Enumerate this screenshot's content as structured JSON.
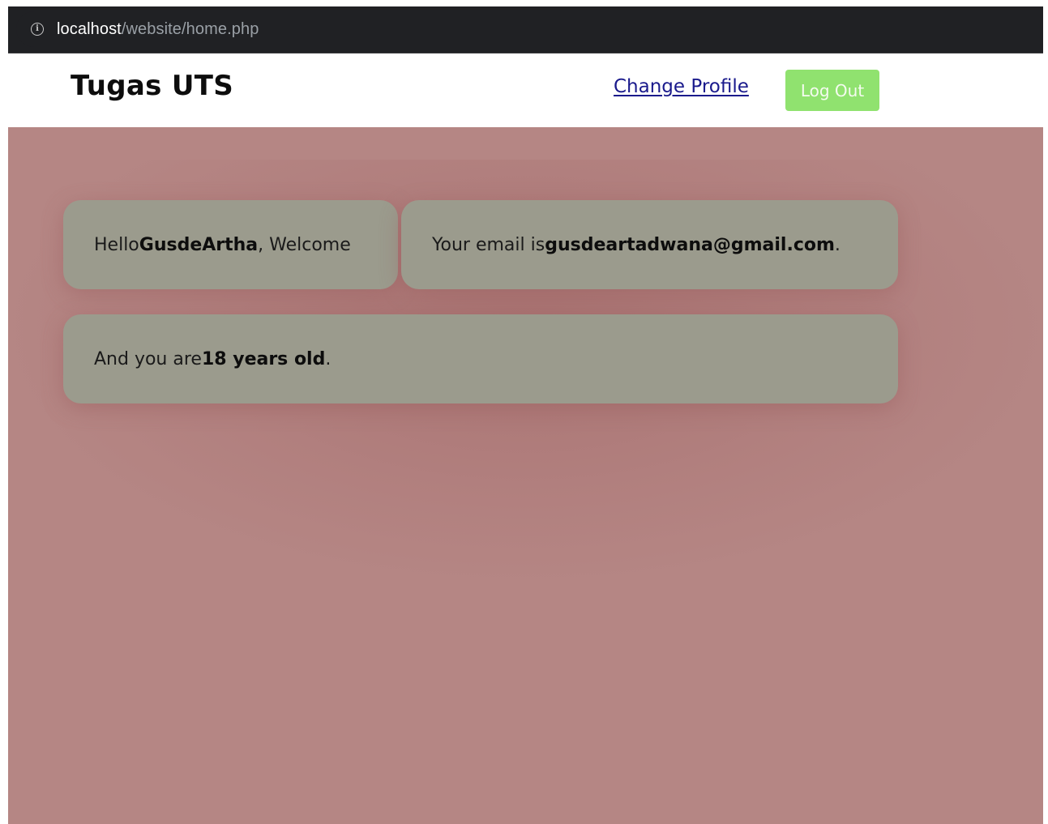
{
  "browser": {
    "url_host": "localhost",
    "url_path": "/website/home.php",
    "info_icon_glyph": "i"
  },
  "header": {
    "title": "Tugas UTS",
    "change_profile_label": "Change Profile",
    "logout_label": "Log Out"
  },
  "cards": {
    "hello": {
      "prefix": "Hello ",
      "name": "GusdeArtha",
      "suffix": ", Welcome"
    },
    "email": {
      "prefix": "Your email is ",
      "value": "gusdeartadwana@gmail.com",
      "suffix": "."
    },
    "age": {
      "prefix": "And you are ",
      "value": "18 years old",
      "suffix": "."
    }
  },
  "colors": {
    "page_background": "#b58684",
    "card_background": "#9b9b8d",
    "logout_button": "#90e26f",
    "link": "#1a1a8c",
    "browser_bar": "#202124"
  },
  "icons": {
    "site_info": "info-circle-icon"
  }
}
